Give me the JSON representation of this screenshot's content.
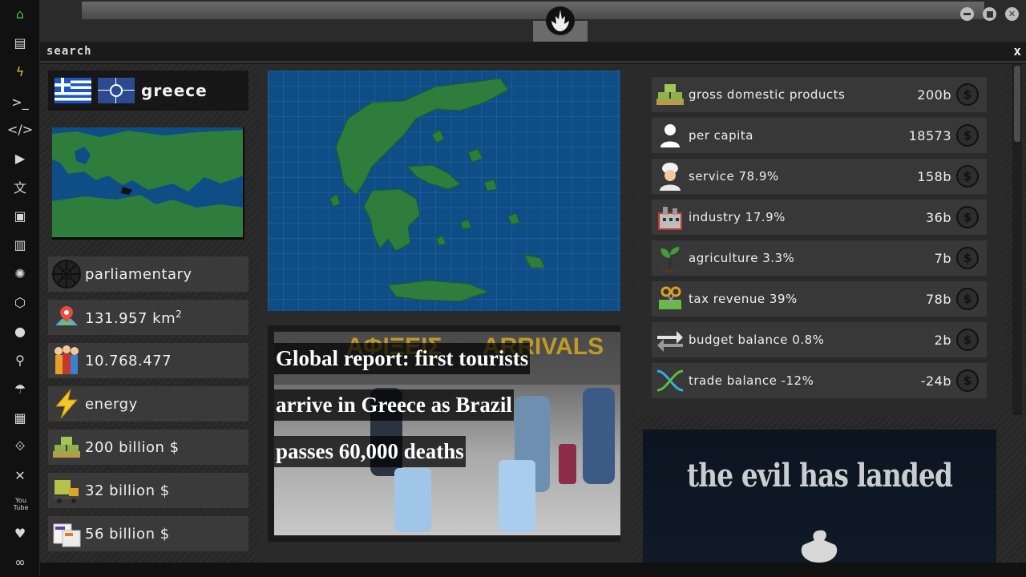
{
  "sidebar": {
    "items": [
      {
        "name": "home-icon",
        "glyph": "⌂",
        "color": "#4fbf45"
      },
      {
        "name": "document-icon",
        "glyph": "▤"
      },
      {
        "name": "lightning-icon",
        "glyph": "ϟ",
        "color": "#e6c020"
      },
      {
        "name": "terminal-icon",
        "glyph": ">_"
      },
      {
        "name": "code-icon",
        "glyph": "</>"
      },
      {
        "name": "play-icon",
        "glyph": "▶"
      },
      {
        "name": "translate-icon",
        "glyph": "文"
      },
      {
        "name": "image-icon",
        "glyph": "▣"
      },
      {
        "name": "newspaper-icon",
        "glyph": "▥"
      },
      {
        "name": "empire-icon",
        "glyph": "✺"
      },
      {
        "name": "hexagon-icon",
        "glyph": "⬡"
      },
      {
        "name": "globe-icon",
        "glyph": "●"
      },
      {
        "name": "search-icon",
        "glyph": "⚲"
      },
      {
        "name": "umbrella-icon",
        "glyph": "☂"
      },
      {
        "name": "contact-card-icon",
        "glyph": "▦"
      },
      {
        "name": "link-icon",
        "glyph": "⟐"
      },
      {
        "name": "expand-icon",
        "glyph": "✕"
      },
      {
        "name": "youtube-icon",
        "glyph": "You Tube"
      },
      {
        "name": "heart-icon",
        "glyph": "♥"
      },
      {
        "name": "infinity-icon",
        "glyph": "∞"
      }
    ]
  },
  "search": {
    "label": "search",
    "close": "x"
  },
  "country": {
    "name": "greece"
  },
  "stats": {
    "government": "parliamentary",
    "area_value": "131.957 km",
    "area_exp": "2",
    "population": "10.768.477",
    "energy": "energy",
    "gdp": "200 billion $",
    "industry": "32 billion $",
    "exports": "56 billion $"
  },
  "news": {
    "sign_left": "ΑΦΙΞΕΙΣ",
    "sign_right": "ARRIVALS",
    "line1": " Global report: first tourists",
    "line2": "arrive in Greece as Brazil",
    "line3": "passes 60,000 deaths"
  },
  "economy": [
    {
      "label": "gross domestic products",
      "amount": "200b",
      "icon": "cash-stack-icon"
    },
    {
      "label": "per capita",
      "amount": "18573",
      "icon": "person-icon"
    },
    {
      "label": "service 78.9%",
      "amount": "158b",
      "icon": "chef-icon"
    },
    {
      "label": "industry 17.9%",
      "amount": "36b",
      "icon": "factory-icon"
    },
    {
      "label": "agriculture 3.3%",
      "amount": "7b",
      "icon": "sprout-icon"
    },
    {
      "label": "tax revenue 39%",
      "amount": "78b",
      "icon": "tax-scissors-icon"
    },
    {
      "label": "budget balance 0.8%",
      "amount": "2b",
      "icon": "exchange-arrows-icon"
    },
    {
      "label": "trade balance -12%",
      "amount": "-24b",
      "icon": "trade-cross-icon"
    }
  ],
  "coin_symbol": "$",
  "promo": {
    "text": "the evil has landed"
  }
}
